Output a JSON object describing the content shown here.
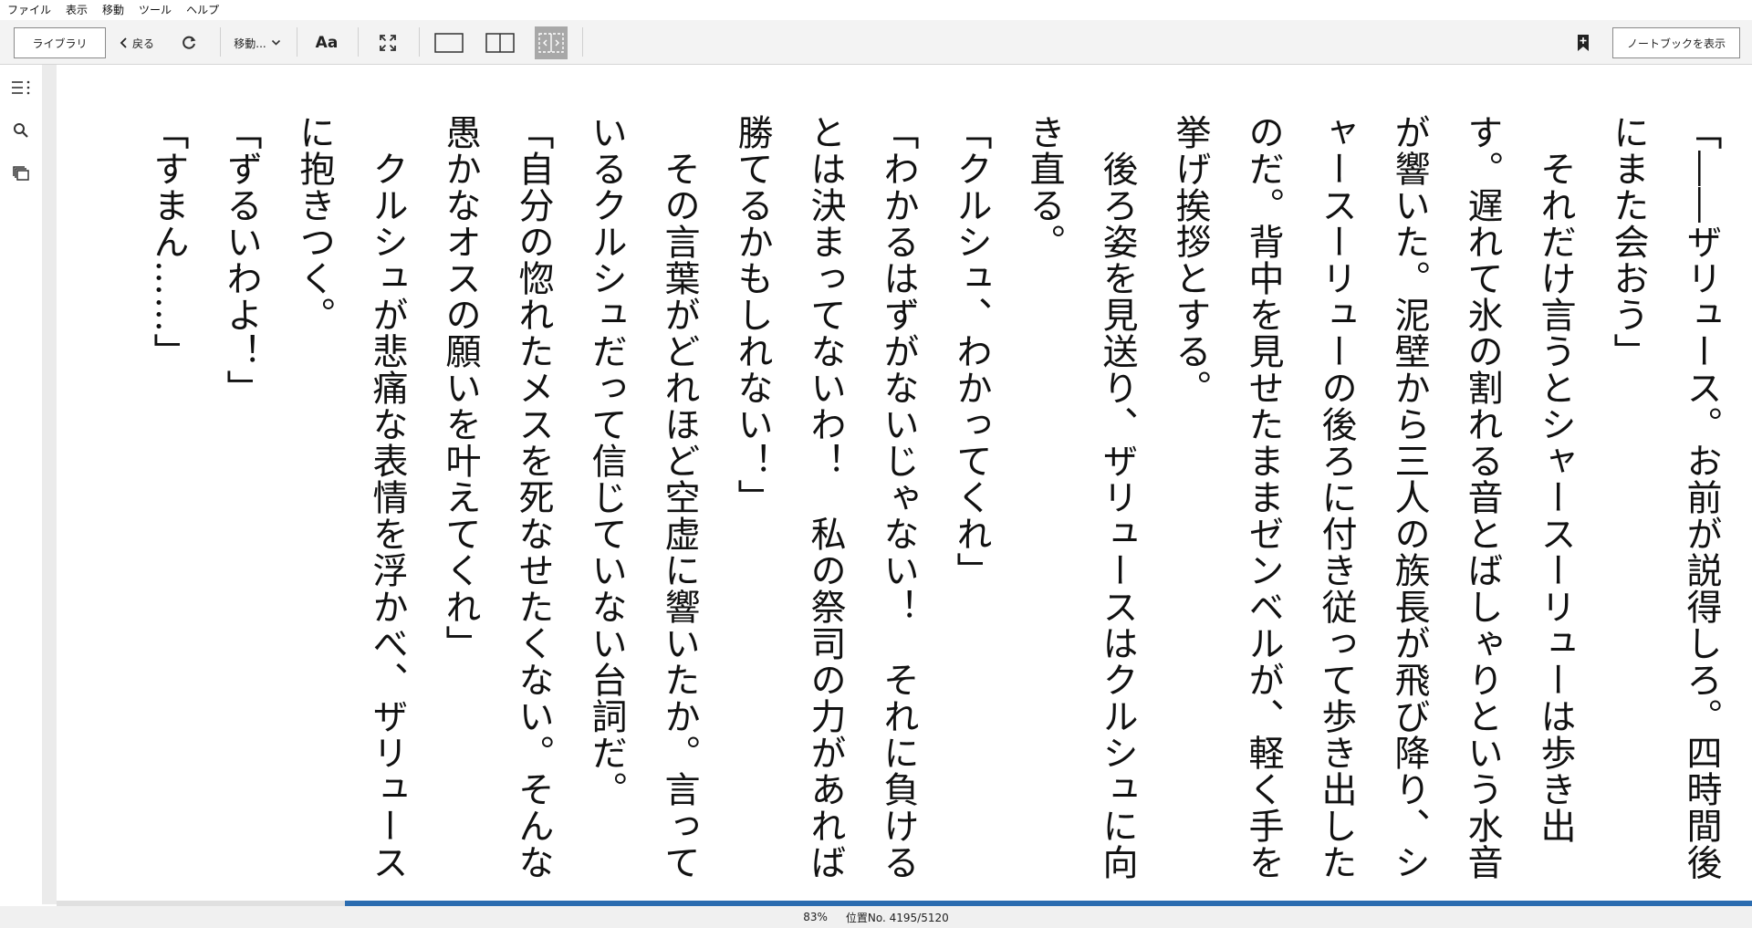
{
  "menubar": {
    "items": [
      "ファイル",
      "表示",
      "移動",
      "ツール",
      "ヘルプ"
    ]
  },
  "toolbar": {
    "library_label": "ライブラリ",
    "back_label": "戻る",
    "goto_label": "移動...",
    "font_label": "Aa",
    "notebook_label": "ノートブックを表示"
  },
  "icons": {
    "back": "chevron-left-icon",
    "refresh": "refresh-icon",
    "goto": "chevron-down-icon",
    "fullscreen": "fullscreen-icon",
    "single_page": "single-page-icon",
    "two_page": "two-page-icon",
    "fit_width": "fit-width-icon",
    "bookmark": "bookmark-add-icon",
    "toc": "table-of-contents-icon",
    "search": "search-icon",
    "flashcards": "flashcards-icon"
  },
  "colors": {
    "accent": "#2b6cb0",
    "active_tool": "#a8a8a8"
  },
  "reader": {
    "paragraphs": [
      "「――ザリュース。お前が説得しろ。四時間後にまた会おう」",
      "　それだけ言うとシャースーリューは歩き出す。遅れて氷の割れる音とばしゃりという水音が響いた。泥壁から三人の族長が飛び降り、シャースーリューの後ろに付き従って歩き出したのだ。背中を見せたままゼンベルが、軽く手を挙げ挨拶とする。",
      "　後ろ姿を見送り、ザリュースはクルシュに向き直る。",
      "「クルシュ、わかってくれ」",
      "「わかるはずがないじゃない！　それに負けるとは決まってないわ！　私の祭司の力があれば勝てるかもしれない！」",
      "　その言葉がどれほど空虚に響いたか。言っているクルシュだって信じていない台詞だ。",
      "「自分の惚れたメスを死なせたくない。そんな愚かなオスの願いを叶えてくれ」",
      "　クルシュが悲痛な表情を浮かべ、ザリュースに抱きつく。",
      "「ずるいわよ！」",
      "「すまん……」"
    ]
  },
  "status": {
    "percent": "83%",
    "location": "位置No. 4195/5120",
    "progress_fraction": 0.83
  }
}
